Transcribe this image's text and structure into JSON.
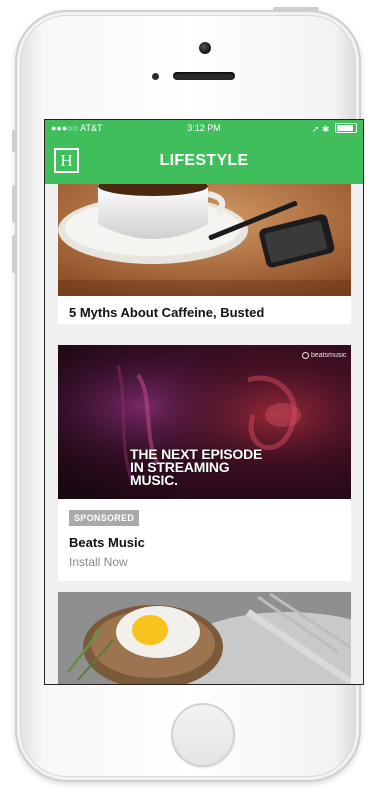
{
  "statusbar": {
    "carrier": "●●●○○ AT&T",
    "time": "3:12 PM",
    "right_indicators": "➚ ✱"
  },
  "navbar": {
    "logo_letter": "H",
    "title": "LIFESTYLE"
  },
  "feed": [
    {
      "title": "5 Myths About Caffeine, Busted",
      "image": "coffee-cup-photo"
    },
    {
      "image": "music-ad-photo",
      "image_text": "THE NEXT EPISODE\nIN STREAMING\nMUSIC.",
      "image_brand": "beatsmusic",
      "badge": "SPONSORED",
      "title": "Beats Music",
      "subtitle": "Install Now"
    },
    {
      "image": "food-photo"
    }
  ],
  "colors": {
    "accent": "#3fbe5b",
    "background": "#f0f0f0",
    "badge": "#a9a9a9"
  }
}
